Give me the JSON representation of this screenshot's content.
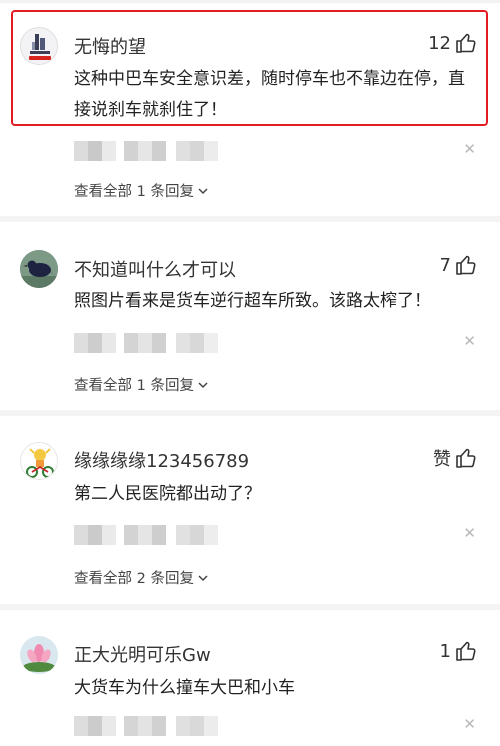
{
  "comments": [
    {
      "username": "无悔的望",
      "likes": "12",
      "text": "这种中巴车安全意识差，随时停车也不靠边在停，直接说刹车就刹住了！",
      "replies": "查看全部 1 条回复",
      "highlighted": true
    },
    {
      "username": "不知道叫什么才可以",
      "likes": "7",
      "text": "照图片看来是货车逆行超车所致。该路太榨了！",
      "replies": "查看全部 1 条回复"
    },
    {
      "username": "缘缘缘缘123456789",
      "likes": "赞",
      "text": "第二人民医院都出动了？",
      "replies": "查看全部 2 条回复"
    },
    {
      "username": "正大光明可乐Gw",
      "likes": "1",
      "text": "大货车为什么撞车大巴和小车"
    }
  ],
  "colors": {
    "highlight": "#e31b23"
  }
}
